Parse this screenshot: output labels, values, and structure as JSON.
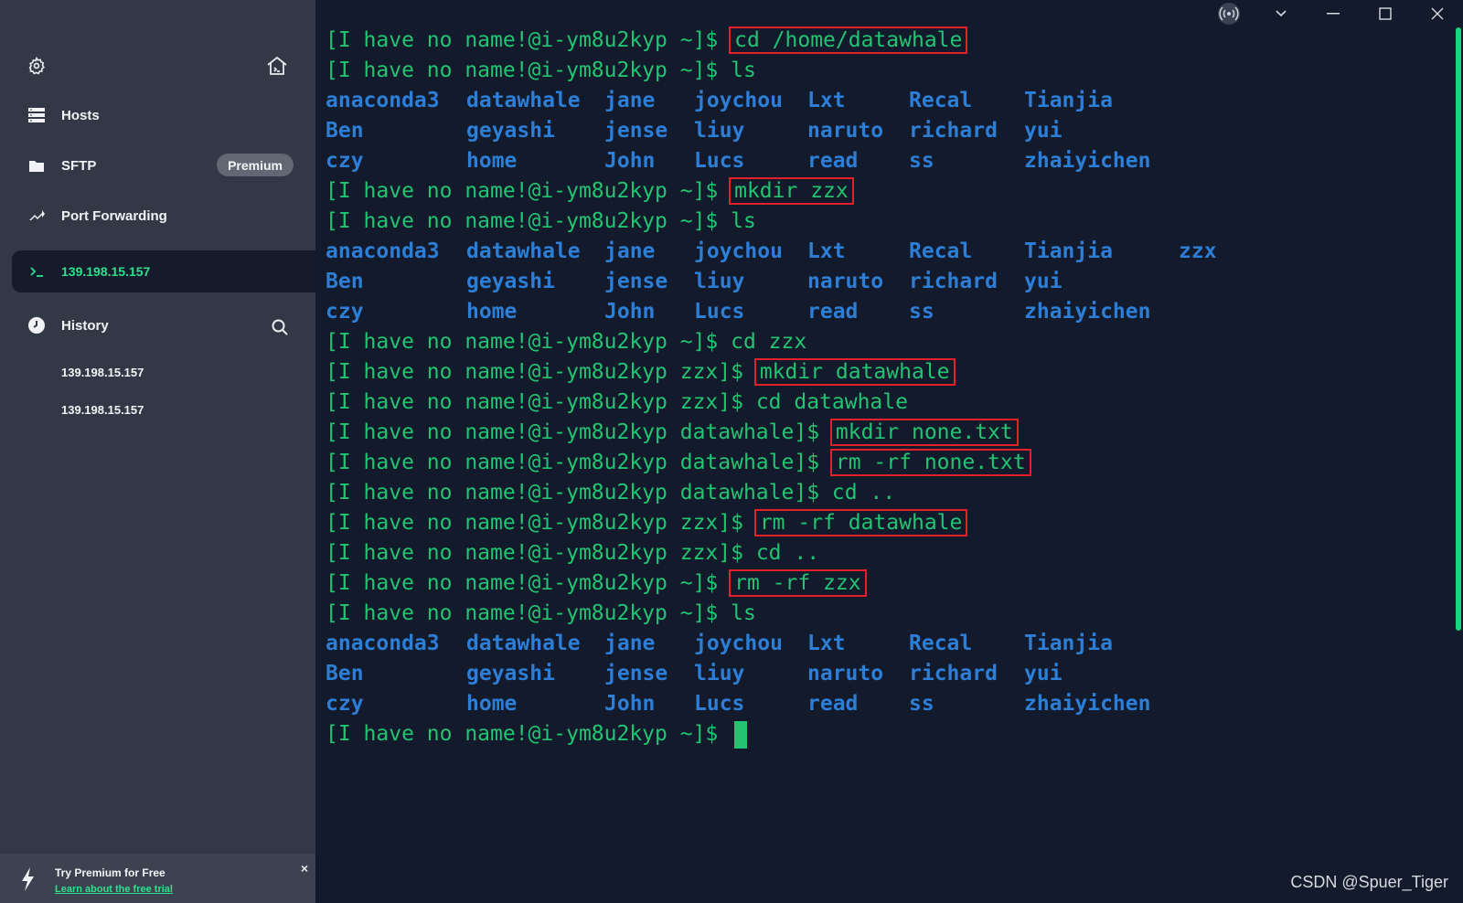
{
  "sidebar": {
    "nav": [
      {
        "label": "Hosts",
        "icon": "hosts-icon"
      },
      {
        "label": "SFTP",
        "icon": "folder-icon",
        "badge": "Premium"
      },
      {
        "label": "Port Forwarding",
        "icon": "port-forwarding-icon"
      }
    ],
    "active_session": "139.198.15.157",
    "history": {
      "label": "History",
      "entries": [
        "139.198.15.157",
        "139.198.15.157"
      ]
    },
    "promo": {
      "title": "Try Premium for Free",
      "link": "Learn about the free trial",
      "close": "×"
    }
  },
  "terminal": {
    "colors": {
      "prompt": "#22c472",
      "directory": "#2c7ed6",
      "highlight_box": "#e4202b"
    },
    "lines": [
      {
        "prompt": "[I have no name!@i-ym8u2kyp ~]$ ",
        "cmd": "cd /home/datawhale",
        "boxed": true
      },
      {
        "prompt": "[I have no name!@i-ym8u2kyp ~]$ ",
        "cmd": "ls",
        "boxed": false
      },
      {
        "dirs": [
          "anaconda3",
          "datawhale",
          "jane",
          "joychou",
          "Lxt",
          "Recal",
          "Tianjia"
        ]
      },
      {
        "dirs": [
          "Ben",
          "geyashi",
          "jense",
          "liuy",
          "naruto",
          "richard",
          "yui"
        ]
      },
      {
        "dirs": [
          "czy",
          "home",
          "John",
          "Lucs",
          "read",
          "ss",
          "zhaiyichen"
        ]
      },
      {
        "prompt": "[I have no name!@i-ym8u2kyp ~]$ ",
        "cmd": "mkdir zzx",
        "boxed": true
      },
      {
        "prompt": "[I have no name!@i-ym8u2kyp ~]$ ",
        "cmd": "ls",
        "boxed": false
      },
      {
        "dirs": [
          "anaconda3",
          "datawhale",
          "jane",
          "joychou",
          "Lxt",
          "Recal",
          "Tianjia",
          "zzx"
        ]
      },
      {
        "dirs": [
          "Ben",
          "geyashi",
          "jense",
          "liuy",
          "naruto",
          "richard",
          "yui"
        ]
      },
      {
        "dirs": [
          "czy",
          "home",
          "John",
          "Lucs",
          "read",
          "ss",
          "zhaiyichen"
        ]
      },
      {
        "prompt": "[I have no name!@i-ym8u2kyp ~]$ ",
        "cmd": "cd zzx",
        "boxed": false
      },
      {
        "prompt": "[I have no name!@i-ym8u2kyp zzx]$ ",
        "cmd": "mkdir datawhale",
        "boxed": true
      },
      {
        "prompt": "[I have no name!@i-ym8u2kyp zzx]$ ",
        "cmd": "cd datawhale",
        "boxed": false
      },
      {
        "prompt": "[I have no name!@i-ym8u2kyp datawhale]$ ",
        "cmd": "mkdir none.txt",
        "boxed": true
      },
      {
        "prompt": "[I have no name!@i-ym8u2kyp datawhale]$ ",
        "cmd": "rm -rf none.txt",
        "boxed": true
      },
      {
        "prompt": "[I have no name!@i-ym8u2kyp datawhale]$ ",
        "cmd": "cd ..",
        "boxed": false
      },
      {
        "prompt": "[I have no name!@i-ym8u2kyp zzx]$ ",
        "cmd": "rm -rf datawhale",
        "boxed": true
      },
      {
        "prompt": "[I have no name!@i-ym8u2kyp zzx]$ ",
        "cmd": "cd ..",
        "boxed": false
      },
      {
        "prompt": "[I have no name!@i-ym8u2kyp ~]$ ",
        "cmd": "rm -rf zzx",
        "boxed": true
      },
      {
        "prompt": "[I have no name!@i-ym8u2kyp ~]$ ",
        "cmd": "ls",
        "boxed": false
      },
      {
        "dirs": [
          "anaconda3",
          "datawhale",
          "jane",
          "joychou",
          "Lxt",
          "Recal",
          "Tianjia"
        ]
      },
      {
        "dirs": [
          "Ben",
          "geyashi",
          "jense",
          "liuy",
          "naruto",
          "richard",
          "yui"
        ]
      },
      {
        "dirs": [
          "czy",
          "home",
          "John",
          "Lucs",
          "read",
          "ss",
          "zhaiyichen"
        ]
      },
      {
        "prompt": "[I have no name!@i-ym8u2kyp ~]$ ",
        "cmd": "",
        "boxed": false,
        "cursor": true
      }
    ]
  },
  "window_controls": [
    "broadcast-icon",
    "chevron-down-icon",
    "minimize-icon",
    "maximize-icon",
    "close-icon"
  ],
  "watermark": "CSDN @Spuer_Tiger"
}
